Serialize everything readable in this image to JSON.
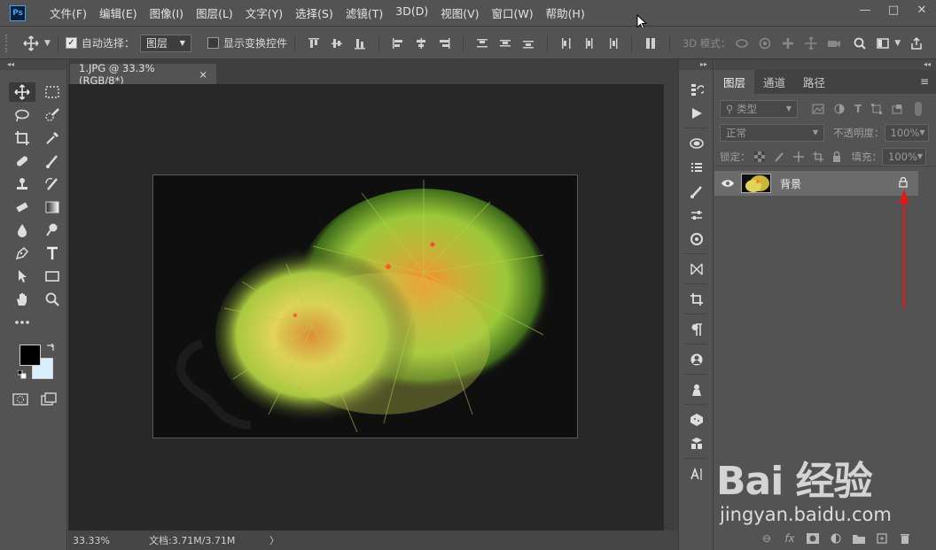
{
  "app": {
    "logo": "Ps"
  },
  "menu": [
    "文件(F)",
    "编辑(E)",
    "图像(I)",
    "图层(L)",
    "文字(Y)",
    "选择(S)",
    "滤镜(T)",
    "3D(D)",
    "视图(V)",
    "窗口(W)",
    "帮助(H)"
  ],
  "window_controls": {
    "minimize": "—",
    "maximize": "□",
    "close": "✕"
  },
  "options_bar": {
    "auto_select_label": "自动选择：",
    "auto_select_checked": true,
    "target_value": "图层",
    "show_transform_label": "显示变换控件",
    "show_transform_checked": false,
    "mode_3d_label": "3D 模式："
  },
  "document": {
    "tab_title": "1.JPG @ 33.3%(RGB/8*)",
    "tab_close": "×",
    "zoom": "33.33%",
    "doc_size": "文档:3.71M/3.71M",
    "status_arrow": "〉"
  },
  "layers_panel": {
    "tabs": [
      "图层",
      "通道",
      "路径"
    ],
    "active_tab": 0,
    "filter_label": "类型",
    "blend_mode": "正常",
    "opacity_label": "不透明度：",
    "opacity_value": "100%",
    "lock_label": "锁定：",
    "fill_label": "填充：",
    "fill_value": "100%",
    "layers": [
      {
        "name": "背景",
        "visible": true,
        "locked": true
      }
    ],
    "bottom_icons": [
      "link-icon",
      "fx-icon",
      "mask-icon",
      "adjustment-icon",
      "folder-icon",
      "new-layer-icon",
      "trash-icon"
    ],
    "fx_label": "fx"
  },
  "annotation": {
    "arrow_color": "#e01919"
  },
  "watermark": {
    "brand": "Bai 经验",
    "url": "jingyan.baidu.com"
  }
}
